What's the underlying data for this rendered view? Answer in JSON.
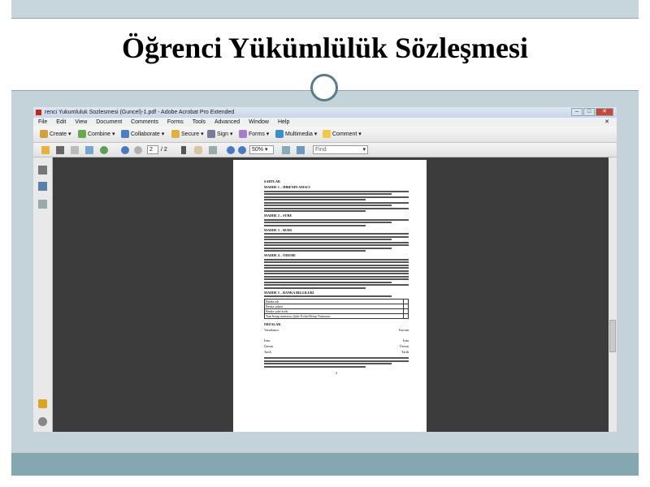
{
  "slide": {
    "title": "Öğrenci Yükümlülük Sözleşmesi"
  },
  "colors": {
    "top_bar": "#c7d6dc",
    "content_bg": "#c3d3d9",
    "bottom_bar": "#85a7b2",
    "circle_border": "#5a7b88"
  },
  "window": {
    "title": "renci Yukumluluk Sozlesmesi (Guncel)-1.pdf - Adobe Acrobat Pro Extended"
  },
  "menu": [
    "File",
    "Edit",
    "View",
    "Document",
    "Comments",
    "Forms",
    "Tools",
    "Advanced",
    "Window",
    "Help"
  ],
  "toolbar": {
    "create": "Create",
    "combine": "Combine",
    "collaborate": "Collaborate",
    "secure": "Secure",
    "sign": "Sign",
    "forms": "Forms",
    "multimedia": "Multimedia",
    "comment": "Comment"
  },
  "nav": {
    "page_current": "2",
    "page_total": "/ 2",
    "zoom": "50%",
    "find_placeholder": "Find"
  },
  "document": {
    "header": "SARTLAR",
    "madde1": "MADDE 1 – HIBENIN AMACI",
    "madde2": "MADDE 2 – SÜRE",
    "madde3": "MADDE 3 – BURS",
    "madde4": "MADDE 4 – ÖDEME",
    "madde5": "MADDE 5 – BANKA BILGILERI",
    "bank_rows": [
      "Banka adı",
      "Banka şubesi",
      "Banka şube kodu",
      "Tam hesap numarası Şube Kodu-Hesap Numarası"
    ],
    "imzalar": "IMZALAR",
    "sig_left": "Yararlanıcı",
    "sig_right": "Kurum",
    "isim": "İsim",
    "unvan": "Ünvan",
    "tarih": "Tarih",
    "page_number": "2"
  }
}
